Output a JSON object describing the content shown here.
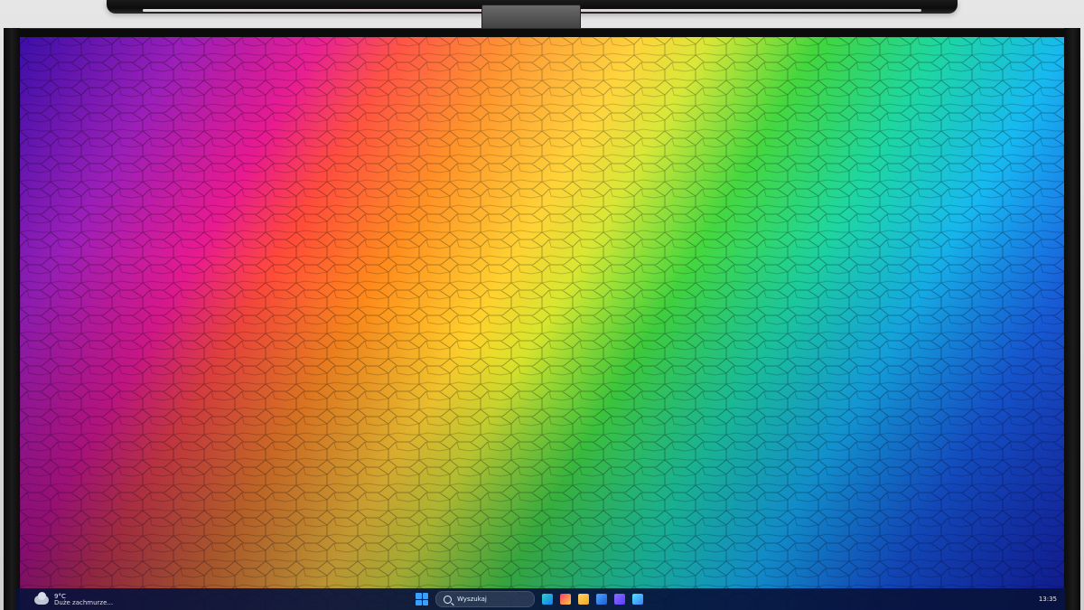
{
  "taskbar": {
    "weather": {
      "temperature": "9°C",
      "description": "Duże zachmurze..."
    },
    "search": {
      "label": "Wyszukaj"
    },
    "clock": "13:35"
  },
  "icons": {
    "start": "windows-logo",
    "search": "search-icon",
    "pinned": [
      "edge-icon",
      "store-icon",
      "file-explorer-icon",
      "mail-icon",
      "teams-icon",
      "photos-icon"
    ]
  },
  "colors": {
    "taskbar": "#08123C",
    "wallpaper": [
      "#3B0FA8",
      "#E81A8F",
      "#FF8A1A",
      "#FFD02A",
      "#41D63A",
      "#17B9F0",
      "#1D2BB6"
    ]
  }
}
